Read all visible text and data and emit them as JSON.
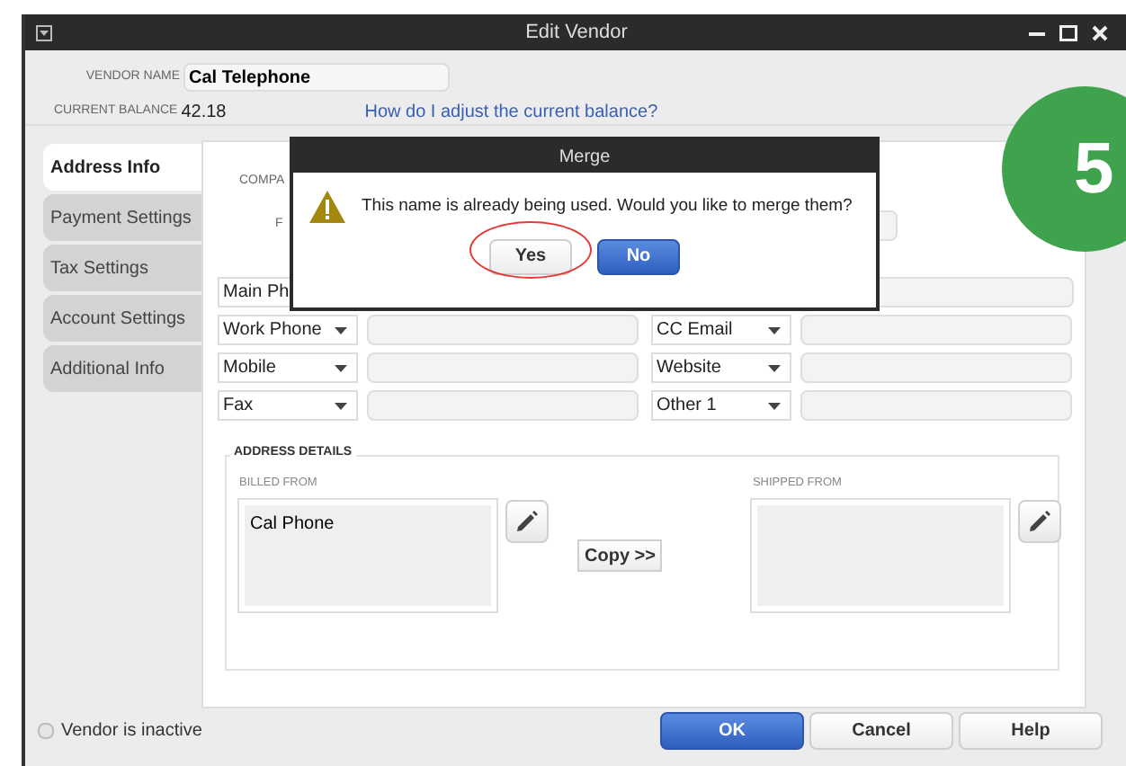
{
  "window": {
    "title": "Edit Vendor"
  },
  "vendor_name": {
    "label": "VENDOR NAME",
    "value": "Cal Telephone"
  },
  "current_balance": {
    "label": "CURRENT BALANCE",
    "value": "42.18"
  },
  "help_link": "How do I adjust the current balance?",
  "tabs": [
    {
      "label": "Address Info",
      "selected": true
    },
    {
      "label": "Payment Settings",
      "selected": false
    },
    {
      "label": "Tax Settings",
      "selected": false
    },
    {
      "label": "Account Settings",
      "selected": false
    },
    {
      "label": "Additional Info",
      "selected": false
    }
  ],
  "company_label": "COMPA",
  "full_name_label": "F",
  "contact_rows": [
    {
      "left": "Main Ph"
    },
    {
      "left": "Work Phone",
      "right": "CC Email"
    },
    {
      "left": "Mobile",
      "right": "Website"
    },
    {
      "left": "Fax",
      "right": "Other 1"
    }
  ],
  "address": {
    "title": "ADDRESS DETAILS",
    "billed_label": "BILLED FROM",
    "billed_value": "Cal Phone",
    "shipped_label": "SHIPPED FROM",
    "copy_button": "Copy >>"
  },
  "inactive": {
    "label": "Vendor is inactive",
    "checked": false
  },
  "buttons": [
    {
      "label": "OK",
      "kind": "primary"
    },
    {
      "label": "Cancel",
      "kind": "normal"
    },
    {
      "label": "Help",
      "kind": "normal"
    }
  ],
  "merge_dialog": {
    "title": "Merge",
    "message": "This name is already being used. Would you like to merge them?",
    "buttons": [
      {
        "label": "Yes",
        "kind": "normal",
        "highlighted": true
      },
      {
        "label": "No",
        "kind": "primary",
        "highlighted": false
      }
    ]
  },
  "step_badge": "5"
}
